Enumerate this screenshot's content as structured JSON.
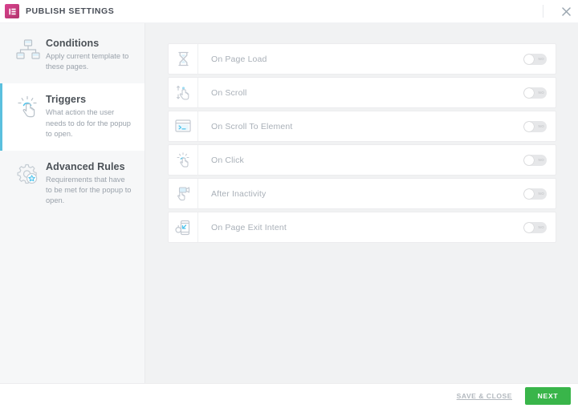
{
  "header": {
    "title": "PUBLISH SETTINGS",
    "logo_icon": "elementor-logo-icon",
    "close_icon": "close-icon"
  },
  "sidebar": {
    "items": [
      {
        "label": "Conditions",
        "desc": "Apply current template to these pages.",
        "icon": "sitemap-icon",
        "active": false
      },
      {
        "label": "Triggers",
        "desc": "What action the user needs to do for the popup to open.",
        "icon": "click-hand-icon",
        "active": true
      },
      {
        "label": "Advanced Rules",
        "desc": "Requirements that have to be met for the popup to open.",
        "icon": "gear-star-icon",
        "active": false
      }
    ]
  },
  "main": {
    "triggers": [
      {
        "label": "On Page Load",
        "icon": "hourglass-icon",
        "toggle_state": "NO",
        "enabled": false
      },
      {
        "label": "On Scroll",
        "icon": "scroll-hand-icon",
        "toggle_state": "NO",
        "enabled": false
      },
      {
        "label": "On Scroll To Element",
        "icon": "browser-window-icon",
        "toggle_state": "NO",
        "enabled": false
      },
      {
        "label": "On Click",
        "icon": "click-hand-icon",
        "toggle_state": "NO",
        "enabled": false
      },
      {
        "label": "After Inactivity",
        "icon": "inactivity-hand-icon",
        "toggle_state": "NO",
        "enabled": false
      },
      {
        "label": "On Page Exit Intent",
        "icon": "exit-intent-icon",
        "toggle_state": "NO",
        "enabled": false
      }
    ]
  },
  "footer": {
    "save_close_label": "SAVE & CLOSE",
    "next_label": "NEXT"
  },
  "colors": {
    "accent_blue": "#5bc0de",
    "brand_pink": "#d9418e",
    "next_green": "#39b54a",
    "content_bg": "#f1f2f3",
    "sidebar_bg": "#f6f7f8"
  }
}
